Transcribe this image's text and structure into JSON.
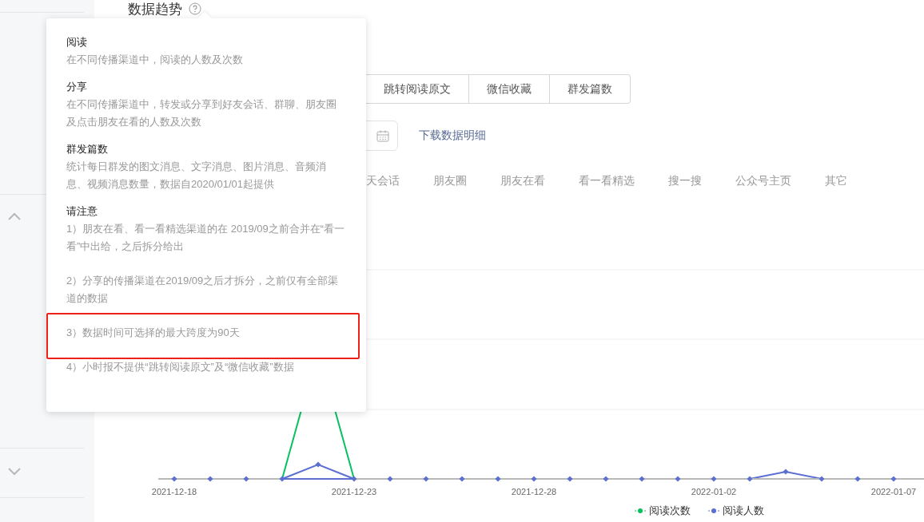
{
  "section": {
    "title": "数据趋势"
  },
  "metric_tabs": [
    {
      "label": "跳转阅读原文",
      "selected": false
    },
    {
      "label": "微信收藏",
      "selected": false
    },
    {
      "label": "群发篇数",
      "selected": false
    }
  ],
  "download_link": "下载数据明细",
  "channel_tabs": [
    {
      "label": "天会话",
      "selected": false
    },
    {
      "label": "朋友圈",
      "selected": false
    },
    {
      "label": "朋友在看",
      "selected": false
    },
    {
      "label": "看一看精选",
      "selected": false
    },
    {
      "label": "搜一搜",
      "selected": false
    },
    {
      "label": "公众号主页",
      "selected": false
    },
    {
      "label": "其它",
      "selected": false
    }
  ],
  "chart": {
    "x_labels": [
      "2021-12-18",
      "2021-12-23",
      "2021-12-28",
      "2022-01-02",
      "2022-01-07"
    ],
    "legend": [
      {
        "label": "阅读次数",
        "color": "#07c160"
      },
      {
        "label": "阅读人数",
        "color": "#5b6fd1"
      }
    ]
  },
  "popover": {
    "sections": [
      {
        "kind": "definition",
        "title": "阅读",
        "paragraphs": [
          {
            "text": "在不同传播渠道中，阅读的人数及次数",
            "highlighted": false
          }
        ]
      },
      {
        "kind": "definition",
        "title": "分享",
        "paragraphs": [
          {
            "text": "在不同传播渠道中，转发或分享到好友会话、群聊、朋友圈及点击朋友在看的人数及次数",
            "highlighted": false
          }
        ]
      },
      {
        "kind": "definition",
        "title": "群发篇数",
        "paragraphs": [
          {
            "text": "统计每日群发的图文消息、文字消息、图片消息、音频消息、视频消息数量，数据自2020/01/01起提供",
            "highlighted": false
          }
        ]
      },
      {
        "kind": "notes",
        "title": "请注意",
        "paragraphs": [
          {
            "text": "1）朋友在看、看一看精选渠道的在 2019/09之前合并在“看一看”中出给，之后拆分给出",
            "highlighted": false
          },
          {
            "text": "2）分享的传播渠道在2019/09之后才拆分，之前仅有全部渠道的数据",
            "highlighted": false
          },
          {
            "text": "3）数据时间可选择的最大跨度为90天",
            "highlighted": true
          },
          {
            "text": "4）小时报不提供“跳转阅读原文”及“微信收藏”数据",
            "highlighted": false
          }
        ]
      }
    ]
  }
}
